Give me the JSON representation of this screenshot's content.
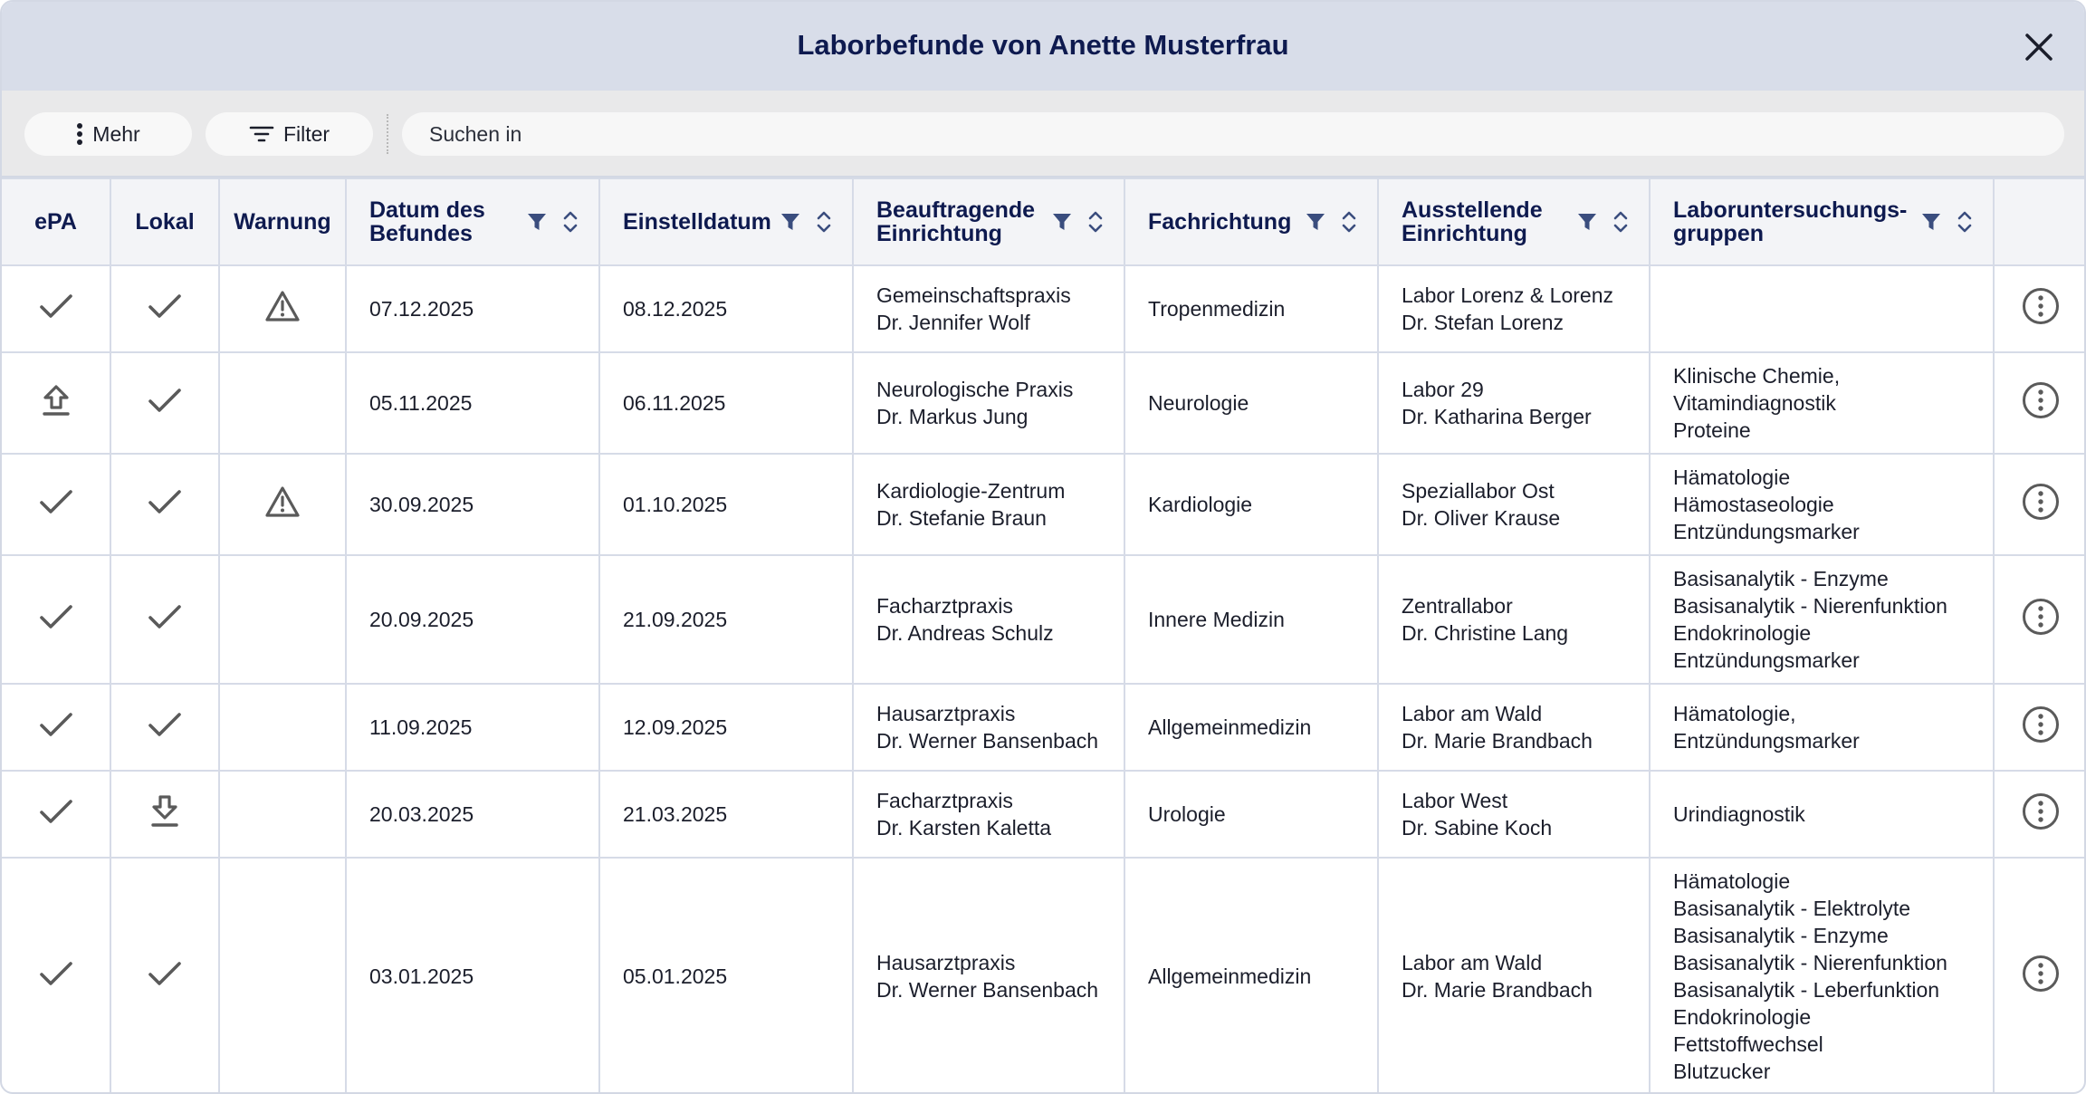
{
  "dialog": {
    "title": "Laborbefunde von Anette Musterfrau"
  },
  "toolbar": {
    "more_label": "Mehr",
    "filter_label": "Filter",
    "search_placeholder": "Suchen in"
  },
  "table": {
    "headers": {
      "epa": "ePA",
      "lokal": "Lokal",
      "warnung": "Warnung",
      "datum": [
        "Datum des",
        "Befundes"
      ],
      "einstelldatum": "Einstelldatum",
      "beauftragende": [
        "Beauftragende",
        "Einrichtung"
      ],
      "fachrichtung": "Fachrichtung",
      "ausstellende": [
        "Ausstellende",
        "Einrichtung"
      ],
      "gruppen": [
        "Laboruntersuchungs-",
        "gruppen"
      ]
    },
    "rows": [
      {
        "epa_icon": "check-icon",
        "lokal_icon": "check-icon",
        "warning": true,
        "datum": "07.12.2025",
        "einstelldatum": "08.12.2025",
        "beauftragende": [
          "Gemeinschaftspraxis",
          "Dr. Jennifer Wolf"
        ],
        "fachrichtung": "Tropenmedizin",
        "ausstellende": [
          "Labor Lorenz & Lorenz",
          "Dr. Stefan Lorenz"
        ],
        "gruppen": []
      },
      {
        "epa_icon": "upload-icon",
        "lokal_icon": "check-icon",
        "warning": false,
        "datum": "05.11.2025",
        "einstelldatum": "06.11.2025",
        "beauftragende": [
          "Neurologische Praxis",
          "Dr. Markus Jung"
        ],
        "fachrichtung": "Neurologie",
        "ausstellende": [
          "Labor 29",
          "Dr. Katharina Berger"
        ],
        "gruppen": [
          "Klinische Chemie,",
          "Vitamindiagnostik",
          "Proteine"
        ]
      },
      {
        "epa_icon": "check-icon",
        "lokal_icon": "check-icon",
        "warning": true,
        "datum": "30.09.2025",
        "einstelldatum": "01.10.2025",
        "beauftragende": [
          "Kardiologie-Zentrum",
          "Dr. Stefanie Braun"
        ],
        "fachrichtung": "Kardiologie",
        "ausstellende": [
          "Speziallabor Ost",
          "Dr. Oliver Krause"
        ],
        "gruppen": [
          "Hämatologie",
          "Hämostaseologie",
          "Entzündungsmarker"
        ]
      },
      {
        "epa_icon": "check-icon",
        "lokal_icon": "check-icon",
        "warning": false,
        "datum": "20.09.2025",
        "einstelldatum": "21.09.2025",
        "beauftragende": [
          "Facharztpraxis",
          "Dr. Andreas Schulz"
        ],
        "fachrichtung": "Innere Medizin",
        "ausstellende": [
          "Zentrallabor",
          "Dr. Christine Lang"
        ],
        "gruppen": [
          "Basisanalytik - Enzyme",
          "Basisanalytik - Nierenfunktion",
          "Endokrinologie",
          "Entzündungsmarker"
        ]
      },
      {
        "epa_icon": "check-icon",
        "lokal_icon": "check-icon",
        "warning": false,
        "datum": "11.09.2025",
        "einstelldatum": "12.09.2025",
        "beauftragende": [
          "Hausarztpraxis",
          "Dr. Werner Bansenbach"
        ],
        "fachrichtung": "Allgemeinmedizin",
        "ausstellende": [
          "Labor am Wald",
          "Dr. Marie Brandbach"
        ],
        "gruppen": [
          "Hämatologie,",
          "Entzündungsmarker"
        ]
      },
      {
        "epa_icon": "check-icon",
        "lokal_icon": "download-icon",
        "warning": false,
        "datum": "20.03.2025",
        "einstelldatum": "21.03.2025",
        "beauftragende": [
          "Facharztpraxis",
          "Dr. Karsten Kaletta"
        ],
        "fachrichtung": "Urologie",
        "ausstellende": [
          "Labor West",
          "Dr. Sabine Koch"
        ],
        "gruppen": [
          "Urindiagnostik"
        ]
      },
      {
        "epa_icon": "check-icon",
        "lokal_icon": "check-icon",
        "warning": false,
        "datum": "03.01.2025",
        "einstelldatum": "05.01.2025",
        "beauftragende": [
          "Hausarztpraxis",
          "Dr. Werner Bansenbach"
        ],
        "fachrichtung": "Allgemeinmedizin",
        "ausstellende": [
          "Labor am Wald",
          "Dr. Marie Brandbach"
        ],
        "gruppen": [
          "Hämatologie",
          "Basisanalytik - Elektrolyte",
          "Basisanalytik - Enzyme",
          "Basisanalytik - Nierenfunktion",
          "Basisanalytik - Leberfunktion",
          "Endokrinologie",
          "Fettstoffwechsel",
          "Blutzucker"
        ]
      }
    ]
  },
  "colors": {
    "titlebar_bg": "#d8dde9",
    "title_text": "#0e1a4f",
    "header_icon": "#3a4d7e",
    "grid_line": "#d6dbe7"
  }
}
